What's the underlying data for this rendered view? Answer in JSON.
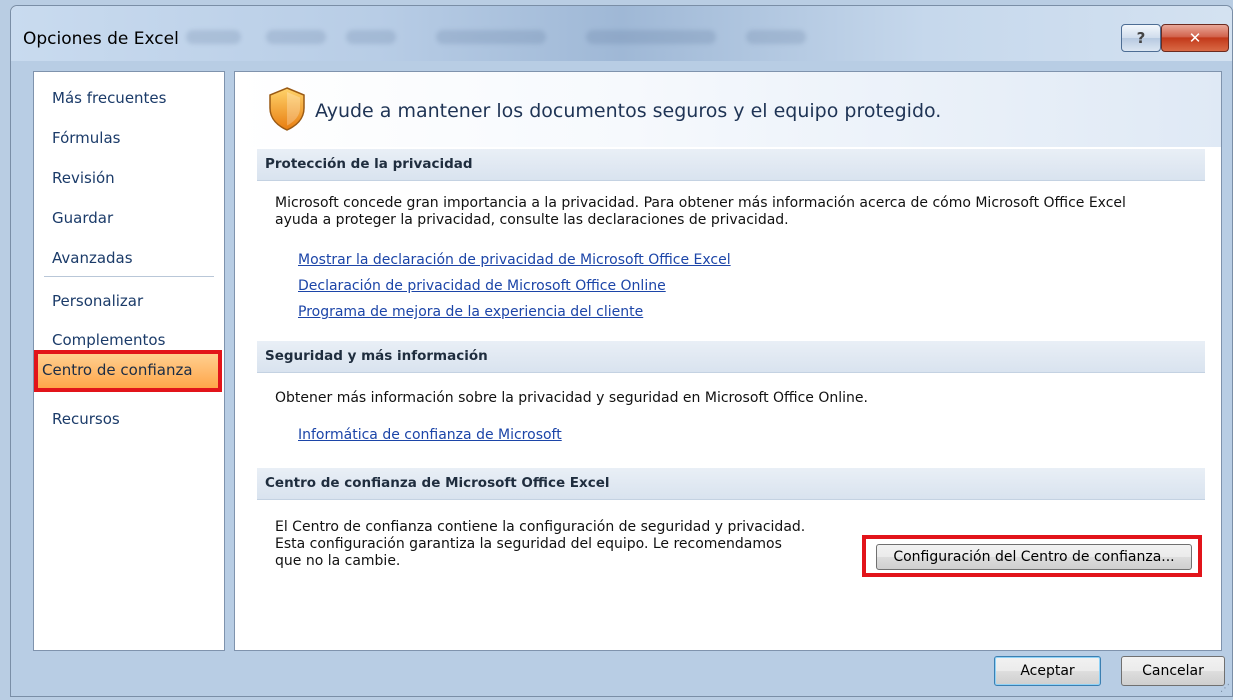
{
  "window": {
    "title": "Opciones de Excel",
    "help_glyph": "?",
    "close_glyph": "✕"
  },
  "sidebar": {
    "items": [
      {
        "label": "Más frecuentes"
      },
      {
        "label": "Fórmulas"
      },
      {
        "label": "Revisión"
      },
      {
        "label": "Guardar"
      },
      {
        "label": "Avanzadas"
      },
      {
        "label": "Personalizar"
      },
      {
        "label": "Complementos"
      },
      {
        "label": "Centro de confianza",
        "selected": true
      },
      {
        "label": "Recursos"
      }
    ]
  },
  "main": {
    "banner_text": "Ayude a mantener los documentos seguros y el equipo protegido.",
    "sections": {
      "privacy": {
        "header": "Protección de la privacidad",
        "paragraph_line1": "Microsoft concede gran importancia a la privacidad. Para obtener más información acerca de cómo Microsoft Office Excel",
        "paragraph_line2": "ayuda a proteger la privacidad, consulte las declaraciones de privacidad.",
        "links": [
          "Mostrar la declaración de privacidad de Microsoft Office Excel",
          "Declaración de privacidad de Microsoft Office Online",
          "Programa de mejora de la experiencia del cliente"
        ]
      },
      "security": {
        "header": "Seguridad y más información",
        "paragraph": "Obtener más información sobre la privacidad y seguridad en Microsoft Office Online.",
        "link": "Informática de confianza de Microsoft"
      },
      "trust_center": {
        "header": "Centro de confianza de Microsoft Office Excel",
        "paragraph_line1": "El Centro de confianza contiene la configuración de seguridad y privacidad.",
        "paragraph_line2": "Esta configuración garantiza la seguridad del equipo. Le recomendamos",
        "paragraph_line3": "que no la cambie.",
        "button_label": "Configuración del Centro de confianza..."
      }
    }
  },
  "footer": {
    "ok_label": "Aceptar",
    "cancel_label": "Cancelar"
  },
  "colors": {
    "highlight_border": "#e2141a",
    "selected_item_bg": "#ffb760",
    "link": "#1c45a8"
  }
}
